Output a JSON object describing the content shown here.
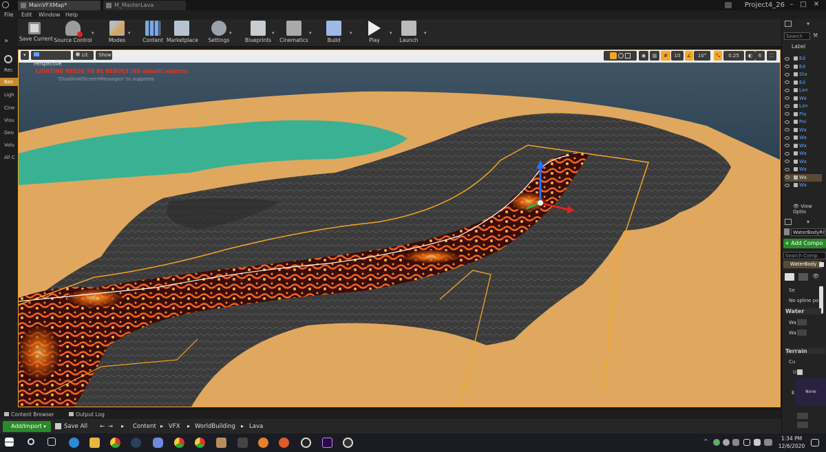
{
  "window": {
    "tabs": [
      "MainVFXMap*",
      "M_MasterLava"
    ],
    "project": "Project4_26"
  },
  "menu": [
    "File",
    "Edit",
    "Window",
    "Help"
  ],
  "toolbar": [
    {
      "label": "Save Current",
      "icon": "save-icon"
    },
    {
      "label": "Source Control",
      "icon": "source-control-icon"
    },
    {
      "label": "Modes",
      "icon": "modes-icon"
    },
    {
      "label": "Content",
      "icon": "content-icon"
    },
    {
      "label": "Marketplace",
      "icon": "marketplace-icon"
    },
    {
      "label": "Settings",
      "icon": "settings-icon"
    },
    {
      "label": "Blueprints",
      "icon": "blueprints-icon"
    },
    {
      "label": "Cinematics",
      "icon": "cinematics-icon"
    },
    {
      "label": "Build",
      "icon": "build-icon"
    },
    {
      "label": "Play",
      "icon": "play-icon"
    },
    {
      "label": "Launch",
      "icon": "launch-icon"
    }
  ],
  "left_tabs": [
    "Rec",
    "Bas",
    "Ligh",
    "Cine",
    "Visu",
    "Geo",
    "Volu",
    "All C"
  ],
  "viewport": {
    "perspective": "Perspective",
    "lit": "Lit",
    "show": "Show",
    "warning": "LIGHTING NEEDS TO BE REBUILT (65 unbuilt objects)",
    "warning_sub": "'DisableAllScreenMessages' to suppress",
    "grid": "10",
    "angle": "10°",
    "scale": "0.25",
    "cam_speed": "6"
  },
  "outliner": {
    "search_placeholder": "Search",
    "column": "Label",
    "rows": [
      "Ed",
      "Ed",
      "Sta",
      "Ed",
      "Lan",
      "Wa",
      "Lan",
      "Pla",
      "Poi",
      "Wa",
      "Wa",
      "Wa",
      "Wa",
      "Wa",
      "Wa",
      "Wa",
      "Wa"
    ],
    "view_options": "View Optio"
  },
  "details": {
    "actor": "WaterBodyRiv",
    "add_component": "+ Add Compo",
    "search_comp": "Search Comp",
    "component": "WaterBody",
    "sel_label": "Se",
    "no_spline": "No spline poi",
    "water": "Water",
    "wa1": "Wa",
    "wa2": "Wa",
    "terrain": "Terrain",
    "cu": "Cu",
    "u": "U",
    "none": "None",
    "e": "E"
  },
  "bottom": {
    "content_browser": "Content Browser",
    "output_log": "Output Log",
    "add_import": "Add/Import",
    "save_all": "Save All",
    "path": [
      "Content",
      "VFX",
      "WorldBuilding",
      "Lava"
    ]
  },
  "taskbar": {
    "time": "1:34 PM",
    "date": "12/6/2020"
  },
  "colors": {
    "accent": "#f5a623",
    "warning": "#e8311e",
    "link": "#5aa2ff",
    "green": "#2a8a2a"
  }
}
